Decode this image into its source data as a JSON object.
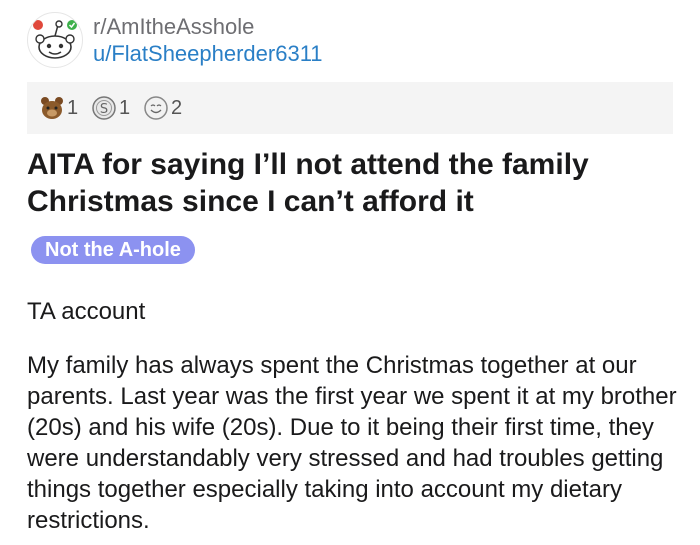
{
  "post": {
    "subreddit": "r/AmItheAsshole",
    "author": "u/FlatSheepherder6311",
    "awards": [
      {
        "icon": "bear-award-icon",
        "count": "1"
      },
      {
        "icon": "silver-award-icon",
        "count": "1"
      },
      {
        "icon": "wholesome-award-icon",
        "count": "2"
      }
    ],
    "title": "AITA for saying I’ll not attend the family Christmas since I can’t afford it",
    "flair": "Not the A-hole",
    "flair_color": "#8c92f0",
    "paragraphs": [
      "TA account",
      "My family has always spent the Christmas together at our parents. Last year was the first year we spent it at my brother (20s) and his wife (20s). Due to it being their first time, they were understandably very stressed and had troubles getting things together especially taking into account my dietary restrictions."
    ]
  }
}
